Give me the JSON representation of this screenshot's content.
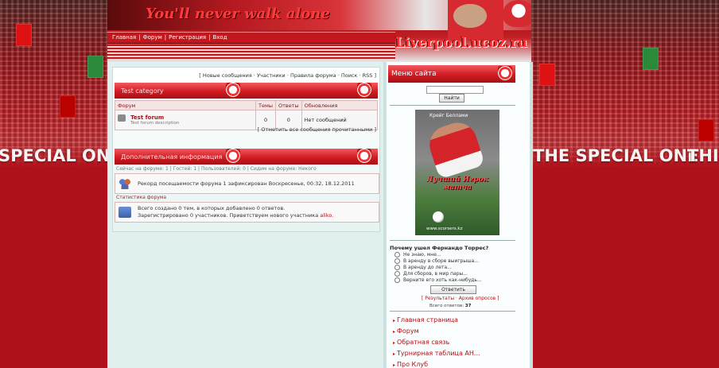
{
  "header": {
    "slogan": "You'll never walk alone",
    "site_name": "Liverpool.ucoz.ru"
  },
  "nav": {
    "items": [
      "Главная",
      "Форум",
      "Регистрация",
      "Вход"
    ]
  },
  "banner": {
    "side_text_left": "SPECIAL ONE",
    "side_text_right": "THE SPECIAL ONE",
    "side_text_right_tail": "THIS"
  },
  "forum": {
    "top_links": "[ Новые сообщения · Участники · Правила форума · Поиск · RSS ]",
    "category_title": "Test category",
    "columns": [
      "Форум",
      "Темы",
      "Ответы",
      "Обновления"
    ],
    "rows": [
      {
        "name": "Test forum",
        "desc": "Test forum description",
        "topics": "0",
        "replies": "0",
        "updated": "Нет сообщений"
      }
    ],
    "mark_read": "[ Отметить все сообщения прочитанными ]"
  },
  "info": {
    "title": "Дополнительная информация",
    "crumbs": "Сейчас на форуме: 1 | Гостей: 1 | Пользователей: 0 | Сидим на форуме: Никого",
    "record_line": "Рекорд посещаемости форума 1 зафиксирован Воскресенье, 00:32, 18.12.2011",
    "stats_label": "Статистика форума",
    "stats_line1": "Всего создано 0 тем, в которых добавлено 0 ответов.",
    "stats_line2_prefix": "Зарегистрировано 0 участников. Приветствуем нового участника ",
    "new_member": "aliko."
  },
  "sidebar": {
    "menu_title": "Меню сайта",
    "search_button": "Найти",
    "poster": {
      "player_name": "Крейг Беллами",
      "caption": "Лучший Игрок матча",
      "url": "www.scorsers.kz"
    },
    "poll": {
      "question": "Почему ушел Фернандо Торрес?",
      "options": [
        "Не знаю, мне...",
        "В аренду в сборе выигрыша...",
        "В аренду до лета...",
        "Для сборов, в мир пары...",
        "Верните его хоть как-нибудь..."
      ],
      "vote_button": "Ответить",
      "links": "[ Результаты · Архив опросов ]",
      "total_label": "Всего ответов:",
      "total_value": "37"
    },
    "menu_items": [
      "Главная страница",
      "Форум",
      "Обратная связь",
      "Турнирная таблица АН...",
      "Про Клуб"
    ]
  },
  "colors": {
    "brand_red": "#c4161d",
    "page_bg": "#b0101a",
    "content_bg": "#dff0ee"
  }
}
